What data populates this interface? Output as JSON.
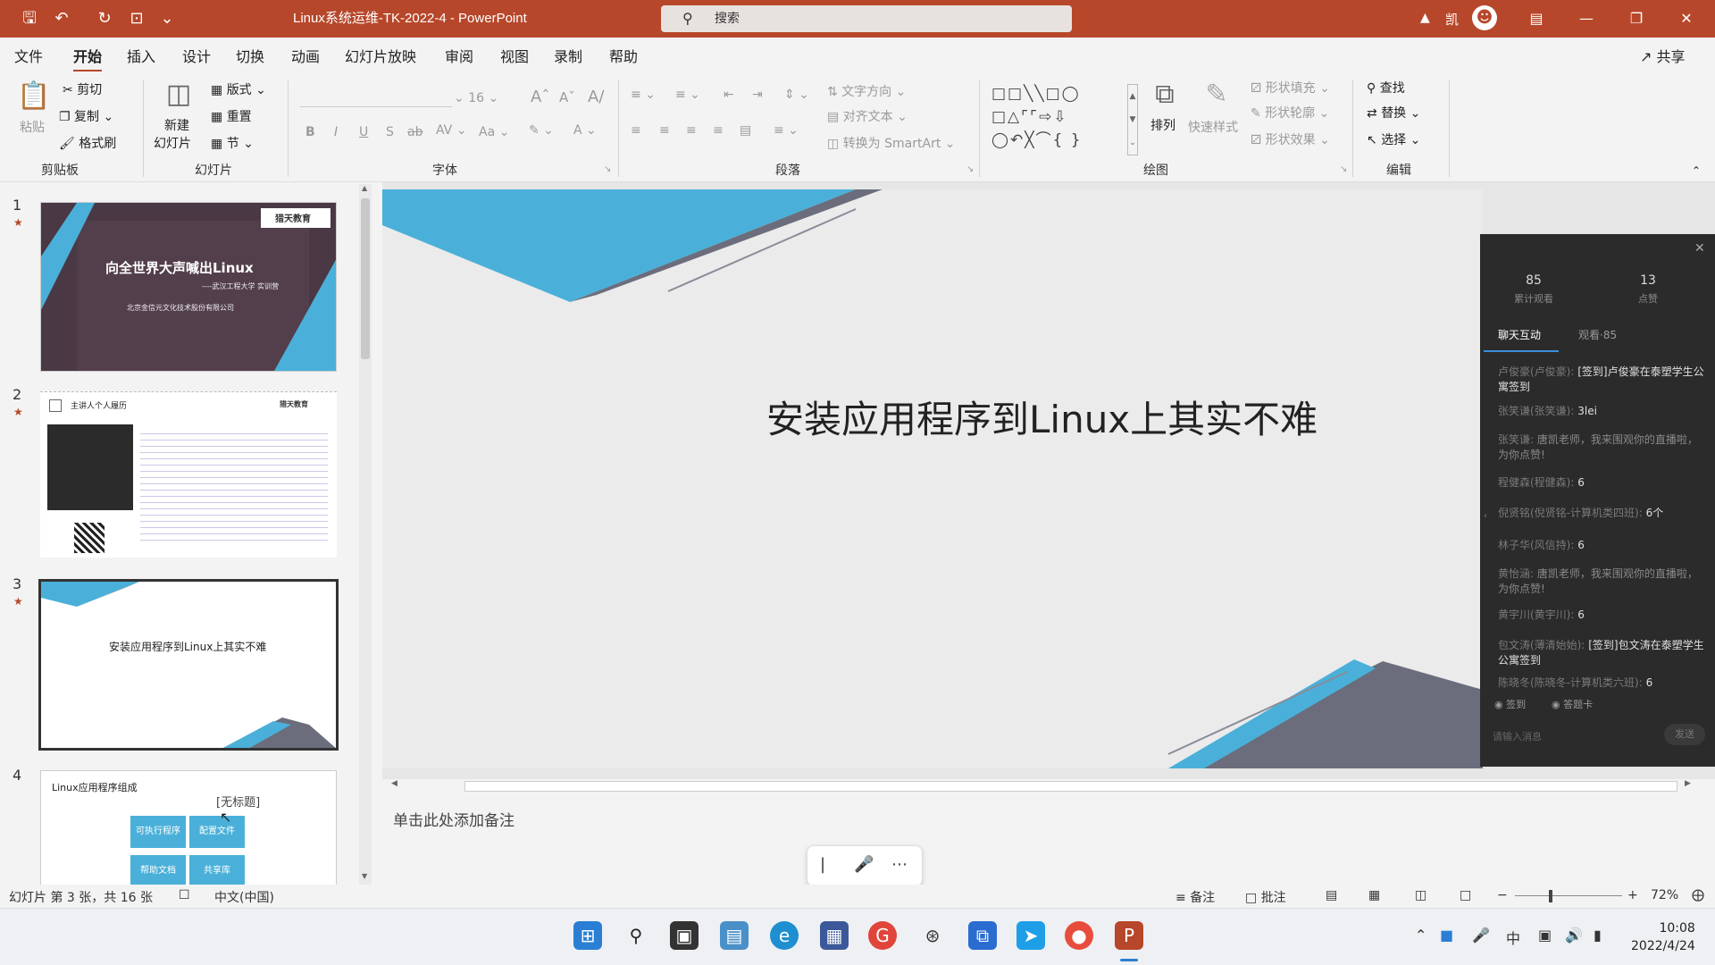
{
  "titlebar": {
    "doc_title": "Linux系统运维-TK-2022-4  -  PowerPoint",
    "search_placeholder": "搜索",
    "user_initial": "凯",
    "qa": {
      "save": "🖫",
      "undo": "↶",
      "redo": "↻",
      "present": "⊡",
      "more": "⌄"
    }
  },
  "menu": {
    "items": [
      "文件",
      "开始",
      "插入",
      "设计",
      "切换",
      "动画",
      "幻灯片放映",
      "审阅",
      "视图",
      "录制",
      "帮助"
    ],
    "active_index": 1,
    "share": "共享"
  },
  "ribbon": {
    "clipboard": {
      "paste": "粘贴",
      "cut": "剪切",
      "copy": "复制",
      "format_painter": "格式刷",
      "group": "剪贴板"
    },
    "slides": {
      "new_slide_1": "新建",
      "new_slide_2": "幻灯片",
      "layout": "版式",
      "reset": "重置",
      "section": "节",
      "group": "幻灯片"
    },
    "font": {
      "size": "16",
      "bold": "B",
      "italic": "I",
      "underline": "U",
      "strike": "S",
      "strikethrough": "ab",
      "spacing": "AV",
      "case": "Aa",
      "group": "字体"
    },
    "paragraph": {
      "text_direction": "文字方向",
      "align_text": "对齐文本",
      "smartart": "转换为 SmartArt",
      "group": "段落"
    },
    "drawing": {
      "arrange": "排列",
      "quick_styles": "快速样式",
      "shape_fill": "形状填充",
      "shape_outline": "形状轮廓",
      "shape_effects": "形状效果",
      "group": "绘图"
    },
    "editing": {
      "find": "查找",
      "replace": "替换",
      "select": "选择",
      "group": "编辑"
    }
  },
  "thumbnails": [
    {
      "num": "1",
      "title": "向全世界大声喊出Linux",
      "subtitle": "----武汉工程大学 实训营",
      "company": "北京金信元文化技术股份有限公司",
      "brand": "猎天教育"
    },
    {
      "num": "2",
      "header": "主讲人个人履历",
      "brand": "猎天教育"
    },
    {
      "num": "3",
      "title": "安装应用程序到Linux上其实不难"
    },
    {
      "num": "4",
      "title": "Linux应用程序组成",
      "placeholder": "[无标题]",
      "tiles": [
        "可执行程序",
        "配置文件",
        "帮助文档",
        "共享库"
      ]
    }
  ],
  "slide": {
    "title": "安装应用程序到Linux上其实不难"
  },
  "chat": {
    "views": "85",
    "views_label": "累计观看",
    "likes": "13",
    "likes_label": "点赞",
    "tab_chat": "聊天互动",
    "tab_viewers": "观看·85",
    "messages": [
      {
        "who": "卢俊豪(卢俊豪):",
        "text": "[签到]卢俊豪在泰塑学生公寓签到"
      },
      {
        "who": "张笑谦(张笑谦):",
        "text": "3lei"
      },
      {
        "who": "张笑谦:",
        "text": "唐凯老师，我来围观你的直播啦，为你点赞!"
      },
      {
        "who": "程健森(程健森):",
        "text": "6"
      },
      {
        "who": "倪贤铭(倪贤铭-计算机类四班):",
        "text": "6个"
      },
      {
        "who": "林子华(风信持):",
        "text": "6"
      },
      {
        "who": "黄怡涵:",
        "text": "唐凯老师，我来围观你的直播啦，为你点赞!"
      },
      {
        "who": "黄宇川(黄宇川):",
        "text": "6"
      },
      {
        "who": "包文涛(薄清始始):",
        "text": "[签到]包文涛在泰塑学生公寓签到"
      },
      {
        "who": "陈晓冬(陈晓冬-计算机类六班):",
        "text": "6"
      }
    ],
    "checkin": "签到",
    "answer_card": "答题卡",
    "input_placeholder": "请输入消息",
    "send": "发送"
  },
  "notes_placeholder": "单击此处添加备注",
  "status": {
    "slide_info": "幻灯片 第 3 张，共 16 张",
    "language": "中文(中国)",
    "notes": "备注",
    "comments": "批注",
    "zoom": "72%"
  },
  "clock": {
    "time": "10:08",
    "date": "2022/4/24"
  },
  "tray": {
    "ime": "中"
  },
  "colors": {
    "accent": "#b7472a",
    "slide_blue": "#4ab0d9",
    "slide_grey": "#6b6d7c"
  }
}
